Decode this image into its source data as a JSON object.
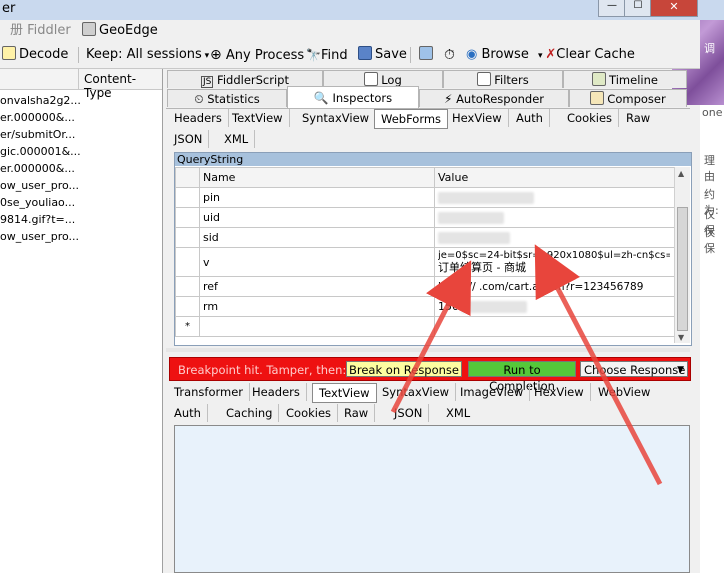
{
  "window": {
    "title": "er",
    "min": "—",
    "max": "☐",
    "close": "✕"
  },
  "menubar": {
    "fiddler_label": "Fiddler",
    "geoedge_label": "GeoEdge"
  },
  "toolbar": {
    "decode": "Decode",
    "keep": "Keep: All sessions",
    "process": "Any Process",
    "find": "Find",
    "save": "Save",
    "browse": "Browse",
    "clear_cache": "Clear Cache"
  },
  "sessions": {
    "header": "Content-Type",
    "rows": [
      "onvalsha2g2...",
      "er.000000&...",
      "er/submitOr...",
      "gic.000001&...",
      "er.000000&...",
      "ow_user_pro...",
      "0se_youliao...",
      "9814.gif?t=...",
      "ow_user_pro..."
    ]
  },
  "tabs_row1": [
    "FiddlerScript",
    "Log",
    "Filters",
    "Timeline"
  ],
  "tabs_row2": [
    "Statistics",
    "Inspectors",
    "AutoResponder",
    "Composer"
  ],
  "request_tabs": [
    "Headers",
    "TextView",
    "SyntaxView",
    "WebForms",
    "HexView",
    "Auth",
    "Cookies",
    "Raw"
  ],
  "request_tabs2": [
    "JSON",
    "XML"
  ],
  "querystring": {
    "title": "QueryString",
    "col_name": "Name",
    "col_value": "Value",
    "rows": [
      {
        "name": "pin",
        "value": ""
      },
      {
        "name": "uid",
        "value": ""
      },
      {
        "name": "sid",
        "value": ""
      },
      {
        "name": "v",
        "value": "je=0$sc=24-bit$sr=1920x1080$ul=zh-cn$cs=U",
        "value2": "订单结算页 -        商城"
      },
      {
        "name": "ref",
        "value": "https://              .com/cart.action?r=123456789"
      },
      {
        "name": "rm",
        "value": "150"
      }
    ],
    "new_row_marker": "*"
  },
  "breakpoint": {
    "text": "Breakpoint hit. Tamper, then:",
    "break_response": "Break on Response",
    "run_completion": "Run to Completion",
    "choose_response": "Choose Response"
  },
  "response_tabs": [
    "Transformer",
    "Headers",
    "TextView",
    "SyntaxView",
    "ImageView",
    "HexView",
    "WebView"
  ],
  "response_tabs2": [
    "Auth",
    "Caching",
    "Cookies",
    "Raw",
    "JSON",
    "XML"
  ],
  "side_text": [
    "调",
    "one",
    "理由",
    "约为:",
    "仅保",
    "仅保"
  ]
}
